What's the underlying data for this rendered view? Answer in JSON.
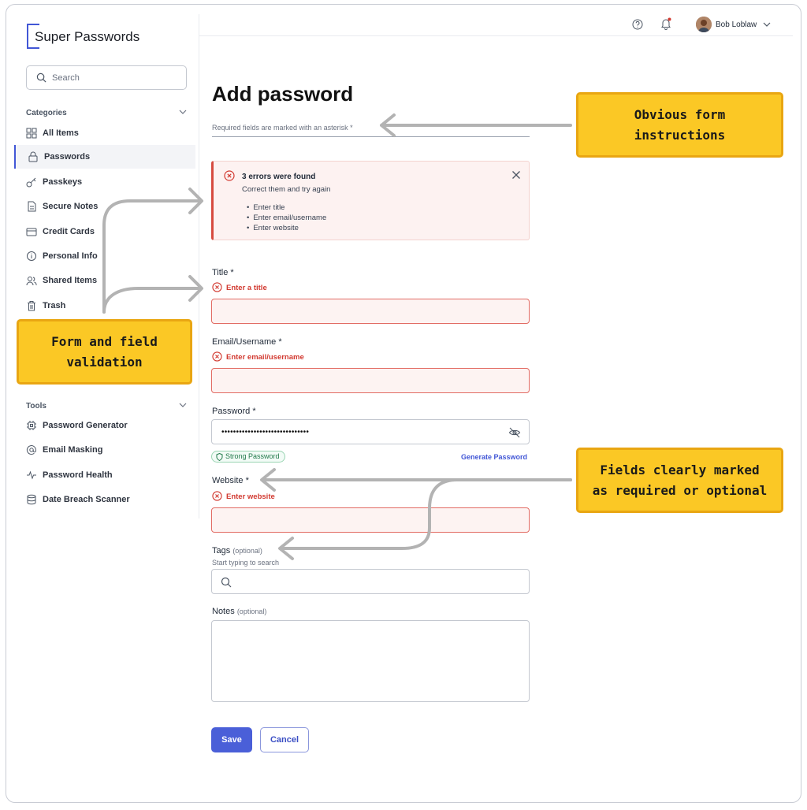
{
  "app": {
    "name": "Super Passwords"
  },
  "search": {
    "placeholder": "Search"
  },
  "sidebar": {
    "categories_label": "Categories",
    "items": [
      {
        "label": "All Items",
        "icon": "grid-icon"
      },
      {
        "label": "Passwords",
        "icon": "lock-icon",
        "active": true
      },
      {
        "label": "Passkeys",
        "icon": "key-icon"
      },
      {
        "label": "Secure Notes",
        "icon": "note-icon"
      },
      {
        "label": "Credit Cards",
        "icon": "card-icon"
      },
      {
        "label": "Personal Info",
        "icon": "info-icon"
      },
      {
        "label": "Shared Items",
        "icon": "users-icon"
      },
      {
        "label": "Trash",
        "icon": "trash-icon"
      }
    ],
    "tools_label": "Tools",
    "tools": [
      {
        "label": "Password Generator",
        "icon": "chip-icon"
      },
      {
        "label": "Email Masking",
        "icon": "at-icon"
      },
      {
        "label": "Password Health",
        "icon": "pulse-icon"
      },
      {
        "label": "Date Breach Scanner",
        "icon": "database-icon"
      }
    ]
  },
  "header": {
    "user_name": "Bob Loblaw",
    "has_notification": true
  },
  "form": {
    "title": "Add password",
    "instructions": "Required fields are marked with an asterisk *",
    "alert": {
      "title": "3 errors were found",
      "subtitle": "Correct them and try again",
      "items": [
        "Enter title",
        "Enter email/username",
        "Enter website"
      ]
    },
    "title_field": {
      "label": "Title *",
      "error": "Enter a  title"
    },
    "email_field": {
      "label": "Email/Username *",
      "error": "Enter email/username"
    },
    "password_field": {
      "label": "Password *",
      "value": "••••••••••••••••••••••••••••••",
      "strength": "Strong Password",
      "generate_label": "Generate Password"
    },
    "website_field": {
      "label": "Website *",
      "error": "Enter website"
    },
    "tags_field": {
      "label": "Tags",
      "optional": "(optional)",
      "hint": "Start typing to search"
    },
    "notes_field": {
      "label": "Notes",
      "optional": "(optional)"
    },
    "save_label": "Save",
    "cancel_label": "Cancel"
  },
  "callouts": {
    "instructions": [
      "Obvious form",
      "instructions"
    ],
    "validation": [
      "Form and field",
      "validation"
    ],
    "required": [
      "Fields clearly marked",
      "as required or optional"
    ]
  },
  "colors": {
    "accent": "#4257d6",
    "error": "#d23a31",
    "callout": "#fbc825",
    "success": "#227a4b"
  }
}
